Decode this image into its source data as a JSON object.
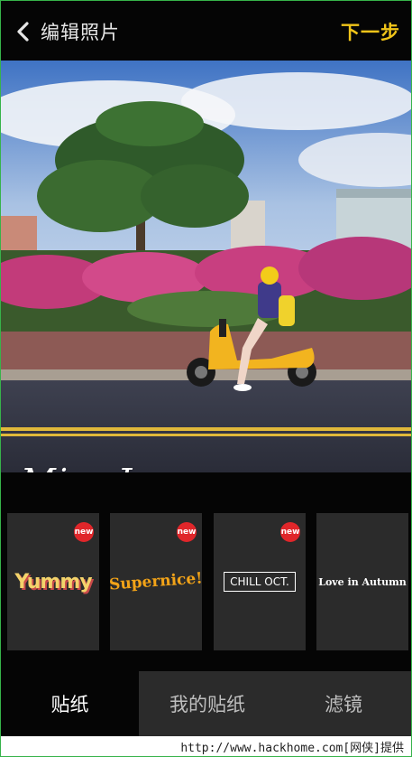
{
  "header": {
    "back_icon": "chevron-left-icon",
    "title": "编辑照片",
    "next_label": "下一步",
    "accent": "#f0c419"
  },
  "photo": {
    "overlay_text": "Miss June"
  },
  "stickers": [
    {
      "text": "Yummy",
      "badge": "new"
    },
    {
      "text": "Supernice!",
      "badge": "new"
    },
    {
      "text": "CHILL OCT.",
      "badge": "new"
    },
    {
      "text": "Love in Autumn",
      "badge": ""
    }
  ],
  "tabs": [
    {
      "label": "贴纸",
      "active": true
    },
    {
      "label": "我的贴纸",
      "active": false
    },
    {
      "label": "滤镜",
      "active": false
    }
  ],
  "footer": {
    "watermark": "http://www.hackhome.com[网侠]提供"
  }
}
